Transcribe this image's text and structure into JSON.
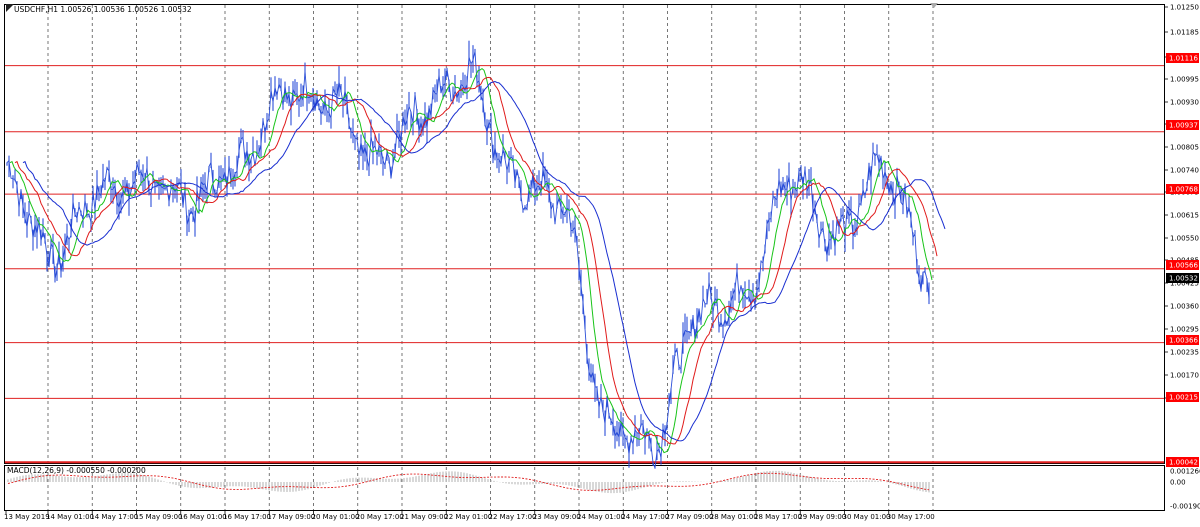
{
  "window": {
    "symbol_title": "USDCHF,H1  1.00526 1.00536 1.00526 1.00532"
  },
  "indicator": {
    "macd_title": "MACD(12,26,9) -0.000550 -0.000200",
    "macd_scale": [
      "0.001266",
      "0.00",
      "-0.001906"
    ]
  },
  "price_axis": {
    "ticks": [
      "1.01250",
      "1.01185",
      "1.01060",
      "1.00995",
      "1.00930",
      "1.00870",
      "1.00805",
      "1.00740",
      "1.00675",
      "1.00615",
      "1.00550",
      "1.00485",
      "1.00425",
      "1.00360",
      "1.00295",
      "1.00235",
      "1.00170",
      "1.00105"
    ],
    "current_price": "1.00532",
    "level_tags": [
      "1.01116",
      "1.00937",
      "1.00768",
      "1.00566",
      "1.00366",
      "1.00215",
      "1.00042"
    ]
  },
  "time_axis": {
    "labels": [
      "13 May 2019",
      "14 May 01:00",
      "14 May 17:00",
      "15 May 09:00",
      "16 May 01:00",
      "16 May 17:00",
      "17 May 09:00",
      "20 May 01:00",
      "20 May 17:00",
      "21 May 09:00",
      "22 May 01:00",
      "22 May 17:00",
      "23 May 09:00",
      "24 May 01:00",
      "24 May 17:00",
      "27 May 09:00",
      "28 May 01:00",
      "28 May 17:00",
      "29 May 09:00",
      "30 May 01:00",
      "30 May 17:00"
    ]
  },
  "colors": {
    "price_series": "#2c4fd8",
    "ma_fast": "#19c419",
    "ma_mid": "#e01b1b",
    "ma_slow": "#1a2fd0",
    "level_line": "#e02020",
    "grid": "#555555",
    "tag_bg": "#ff0000",
    "current_tag_bg": "#000000",
    "macd_hist": "#b0b0b0",
    "macd_signal": "#e02020"
  },
  "chart_data": {
    "type": "line",
    "title": "USDCHF,H1",
    "x": [
      "13 May 2019",
      "14 May 01:00",
      "14 May 17:00",
      "15 May 09:00",
      "16 May 01:00",
      "16 May 17:00",
      "17 May 09:00",
      "20 May 01:00",
      "20 May 17:00",
      "21 May 09:00",
      "22 May 01:00",
      "22 May 17:00",
      "23 May 09:00",
      "24 May 01:00",
      "24 May 17:00",
      "27 May 09:00",
      "28 May 01:00",
      "28 May 17:00",
      "29 May 09:00",
      "30 May 01:00",
      "30 May 17:00"
    ],
    "series": [
      {
        "values": [
          1.0082,
          1.006,
          1.0078,
          1.008,
          1.0075,
          1.0085,
          1.0105,
          1.0102,
          1.0085,
          1.01,
          1.011,
          1.008,
          1.0075,
          1.0015,
          1.001,
          1.0045,
          1.005,
          1.0082,
          1.0065,
          1.0085,
          1.0055
        ]
      }
    ],
    "ylim": [
      1.0004,
      1.0128
    ],
    "horizontal_levels": [
      1.01116,
      1.00937,
      1.00768,
      1.00566,
      1.00366,
      1.00215,
      1.00042
    ],
    "current_price": 1.00532,
    "grid": true
  }
}
